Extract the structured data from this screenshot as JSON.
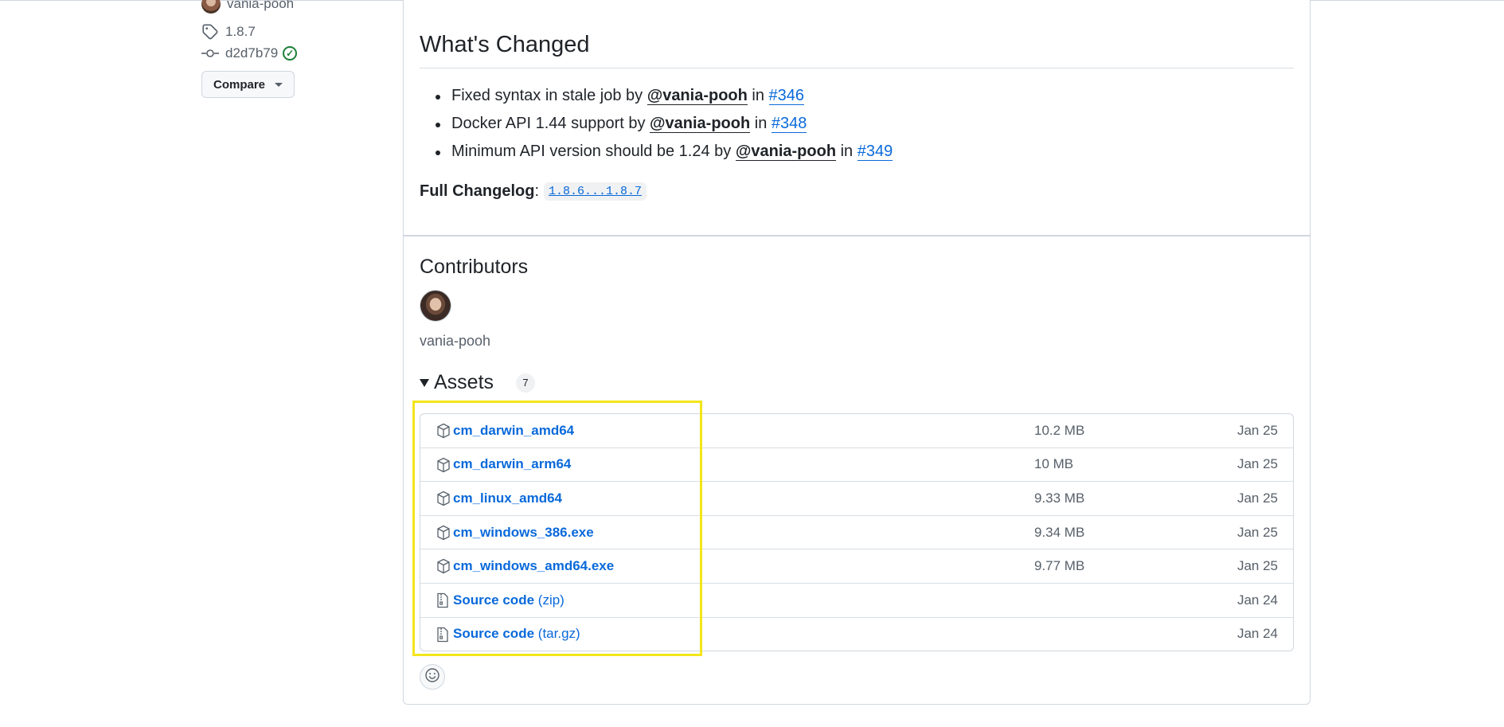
{
  "sidebar": {
    "author": "vania-pooh",
    "tag": "1.8.7",
    "commit": "d2d7b79",
    "compare_label": "Compare"
  },
  "whats_changed": {
    "title": "What's Changed",
    "items": [
      {
        "text": "Fixed syntax in stale job by ",
        "user": "@vania-pooh",
        "in": " in ",
        "pr": "#346"
      },
      {
        "text": "Docker API 1.44 support by ",
        "user": "@vania-pooh",
        "in": " in ",
        "pr": "#348"
      },
      {
        "text": "Minimum API version should be 1.24 by ",
        "user": "@vania-pooh",
        "in": " in ",
        "pr": "#349"
      }
    ],
    "full_changelog_label": "Full Changelog",
    "colon": ":",
    "changelog_link": "1.8.6...1.8.7"
  },
  "contributors": {
    "title": "Contributors",
    "name": "vania-pooh"
  },
  "assets": {
    "title": "Assets",
    "count": "7",
    "rows": [
      {
        "name": "cm_darwin_amd64",
        "ext": "",
        "size": "10.2 MB",
        "date": "Jan 25",
        "icon": "package-icon"
      },
      {
        "name": "cm_darwin_arm64",
        "ext": "",
        "size": "10 MB",
        "date": "Jan 25",
        "icon": "package-icon"
      },
      {
        "name": "cm_linux_amd64",
        "ext": "",
        "size": "9.33 MB",
        "date": "Jan 25",
        "icon": "package-icon"
      },
      {
        "name": "cm_windows_386.exe",
        "ext": "",
        "size": "9.34 MB",
        "date": "Jan 25",
        "icon": "package-icon"
      },
      {
        "name": "cm_windows_amd64.exe",
        "ext": "",
        "size": "9.77 MB",
        "date": "Jan 25",
        "icon": "package-icon"
      },
      {
        "name": "Source code",
        "ext": "(zip)",
        "size": "",
        "date": "Jan 24",
        "icon": "file-zip-icon"
      },
      {
        "name": "Source code",
        "ext": "(tar.gz)",
        "size": "",
        "date": "Jan 24",
        "icon": "file-zip-icon"
      }
    ]
  },
  "colors": {
    "link": "#0969da",
    "verified": "#1a7f37",
    "highlight": "#f3e51a",
    "border": "#d0d7de"
  }
}
